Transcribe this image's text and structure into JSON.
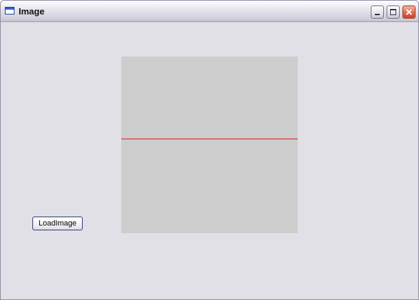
{
  "window": {
    "title": "Image",
    "controls": {
      "minimize": "minimize-icon",
      "maximize": "maximize-icon",
      "close": "close-icon"
    }
  },
  "content": {
    "load_button_label": "LoadImage",
    "image_panel_background": "#cdcdcd",
    "line_color": "#e01a1a"
  },
  "colors": {
    "window_background": "#e1e0e6",
    "close_button": "#e06a4d"
  }
}
